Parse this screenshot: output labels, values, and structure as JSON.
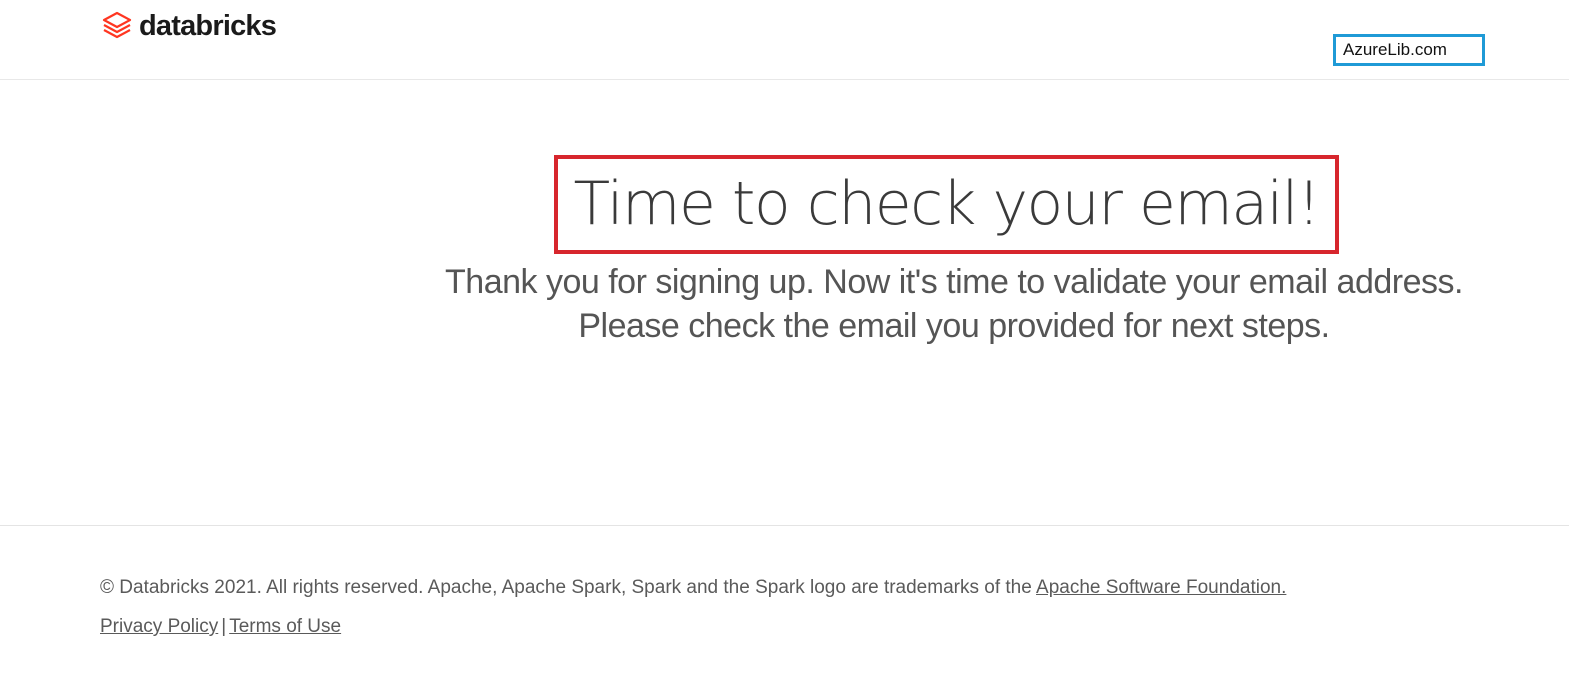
{
  "header": {
    "logo_text": "databricks",
    "logo_icon": "databricks-stack-icon",
    "watermark": "AzureLib.com"
  },
  "main": {
    "title": "Time to check your email!",
    "lead_line1": "Thank you for signing up. Now it's time to validate your email address.",
    "lead_line2": "Please check the email you provided for next steps."
  },
  "footer": {
    "copyright_text": "© Databricks 2021. All rights reserved. Apache, Apache Spark, Spark and the Spark logo are trademarks of the ",
    "apache_link": "Apache Software Foundation.",
    "privacy_link": "Privacy Policy",
    "separator": "|",
    "terms_link": "Terms of Use"
  },
  "colors": {
    "brand_red": "#ff3621",
    "highlight_red": "#d7262d",
    "watermark_blue": "#1f9ad6"
  }
}
